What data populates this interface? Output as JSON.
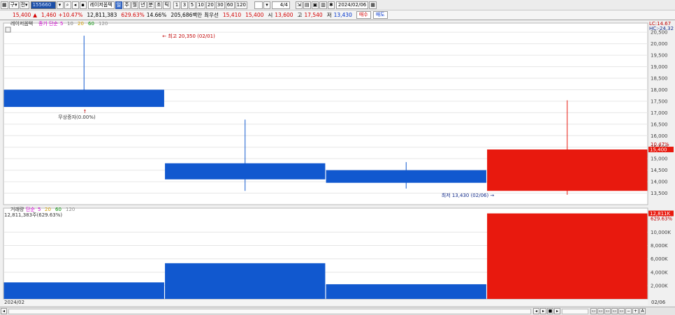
{
  "toolbar": {
    "view_label": "구",
    "type_label": "전",
    "stock_code": "155660",
    "stock_name": "레이저옵텍",
    "periods": [
      "일",
      "주",
      "월",
      "년",
      "분",
      "초",
      "틱"
    ],
    "intervals": [
      "1",
      "3",
      "5",
      "10",
      "20",
      "30",
      "60",
      "120"
    ],
    "page": "4",
    "page_total": "/4",
    "date": "2024/02/06"
  },
  "quote": {
    "price": "15,400",
    "change": "1,460",
    "change_pct": "+10.47%",
    "volume": "12,811,383",
    "volume_pct": "629.63%",
    "turnover": "14.66%",
    "amount": "205,686백만",
    "reference_label": "최우선",
    "bid": "15,410",
    "ask": "15,400",
    "open_label": "시",
    "open": "13,600",
    "high_label": "고",
    "high": "17,540",
    "low_label": "저",
    "low": "13,430",
    "buy_label": "매수",
    "sell_label": "매도"
  },
  "chart_data": {
    "type": "candlestick",
    "price_pane": {
      "title": "레이저옵텍",
      "ma_prefix": "종가 단순",
      "ma_periods": [
        "5",
        "10",
        "20",
        "60",
        "120"
      ],
      "ma_colors": [
        "#d400d4",
        "#808080",
        "#d4a000",
        "#009000",
        "#909090"
      ],
      "ylim": [
        13000,
        20900
      ],
      "y_ticks": [
        13500,
        14000,
        14500,
        15000,
        15500,
        16000,
        16500,
        17000,
        17500,
        18000,
        18500,
        19000,
        19500,
        20000,
        20500
      ],
      "y_tick_labels": [
        "13,500",
        "14,000",
        "14,500",
        "15,000",
        "15,500",
        "16,000",
        "16,500",
        "17,000",
        "17,500",
        "18,000",
        "18,500",
        "19,000",
        "19,500",
        "20,000",
        "20,500"
      ],
      "candles": [
        {
          "open": 18000,
          "high": 20350,
          "low": 17300,
          "close": 17250
        },
        {
          "open": 14800,
          "high": 16700,
          "low": 13600,
          "close": 14100
        },
        {
          "open": 14500,
          "high": 14850,
          "low": 13700,
          "close": 13950
        },
        {
          "open": 13600,
          "high": 17540,
          "low": 13430,
          "close": 15400
        }
      ],
      "up_color": "#e8190e",
      "down_color": "#1158cf",
      "lc_label": "LC:14.67",
      "hc_label": "HC:-24.32",
      "current_price_label": "15,400",
      "current_pct_label": "10.47%",
      "high_annotation": "최고 20,350 (02/01)",
      "low_annotation": "최저 13,430 (02/06)",
      "event_annotation": "무상증자(0.00%)"
    },
    "volume_pane": {
      "title": "거래량",
      "ma_prefix": "단순",
      "ma_periods": [
        "5",
        "20",
        "60",
        "120"
      ],
      "ma_colors": [
        "#d400d4",
        "#d4a000",
        "#009000",
        "#909090"
      ],
      "value_label": "12,811,383주(629.63%)",
      "current_label": "12,811K",
      "current_pct_label": "629.63%",
      "ylim": [
        0,
        13600
      ],
      "y_ticks": [
        2000,
        4000,
        6000,
        8000,
        10000
      ],
      "y_tick_labels": [
        "2,000K",
        "4,000K",
        "6,000K",
        "8,000K",
        "10,000K"
      ],
      "values": [
        2480,
        5350,
        2200,
        12811
      ]
    },
    "x_start_label": "2024/02",
    "x_end_label": "02/06"
  }
}
